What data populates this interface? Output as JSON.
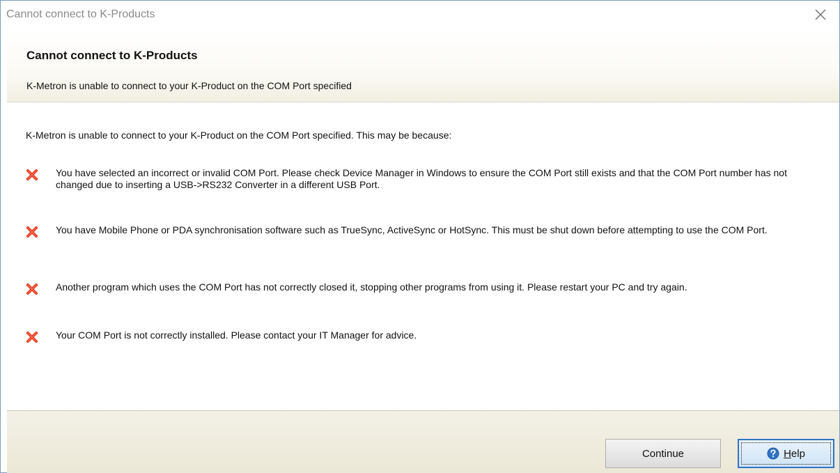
{
  "window": {
    "title": "Cannot connect to K-Products"
  },
  "header": {
    "title": "Cannot connect to K-Products",
    "subtitle": "K-Metron is unable to connect to your K-Product on the COM Port specified"
  },
  "content": {
    "intro": "K-Metron is unable to connect to your K-Product on the COM Port specified.  This may be because:",
    "reasons": [
      {
        "icon": "error-x-icon",
        "text": "You have selected an incorrect or invalid COM Port.  Please check Device Manager in Windows to ensure the COM Port still exists and that the COM Port number has not changed due to inserting a USB->RS232 Converter in a different USB Port."
      },
      {
        "icon": "error-x-icon",
        "text": "You have Mobile Phone or PDA synchronisation software such as TrueSync, ActiveSync or HotSync.  This must be shut down before attempting to use the COM Port."
      },
      {
        "icon": "error-x-icon",
        "text": "Another program which uses the COM Port has not correctly closed it, stopping other programs from using it.  Please restart your PC and try again."
      },
      {
        "icon": "error-x-icon",
        "text": "Your COM Port is not correctly installed.  Please contact your IT Manager for advice."
      }
    ]
  },
  "footer": {
    "continue_label": "Continue",
    "help_label_underlined": "H",
    "help_label_rest": "elp",
    "help_icon": "help-icon"
  },
  "colors": {
    "error": "#e8341c",
    "help_accent": "#2f73c4"
  }
}
